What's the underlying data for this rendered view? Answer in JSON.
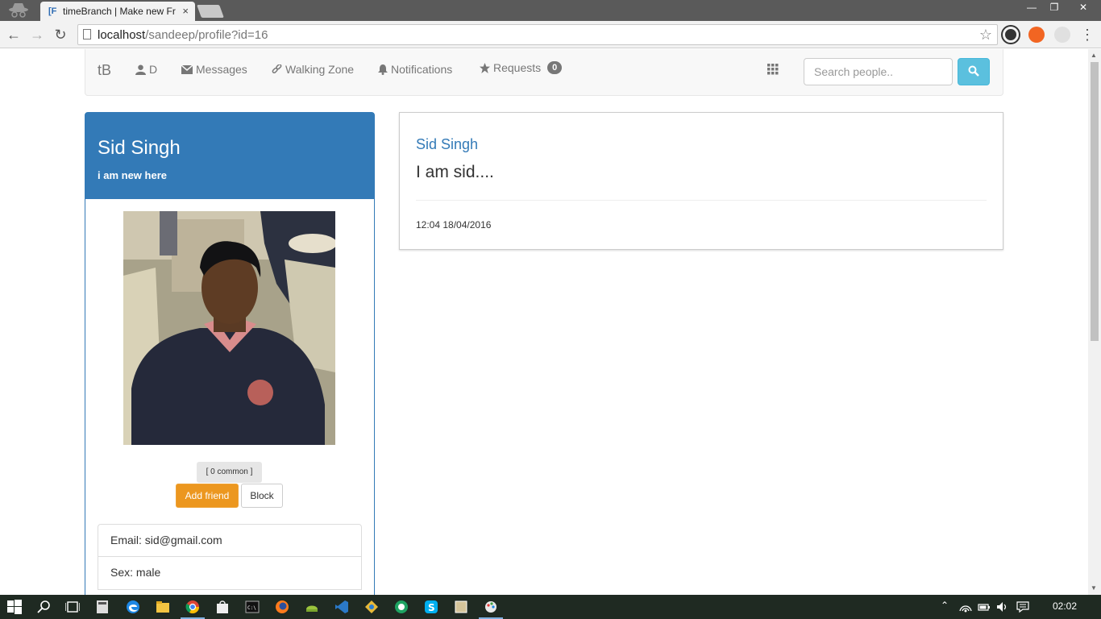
{
  "browser": {
    "tab_title": "timeBranch | Make new Fr",
    "tab_favicon": "[F",
    "tab_close": "×",
    "url_host": "localhost",
    "url_path": "/sandeep/profile?id=16",
    "icons": [
      "incognito-icon",
      "back-icon",
      "forward-icon",
      "reload-icon",
      "page-icon",
      "bookmark-star-icon",
      "menu-icon"
    ]
  },
  "navbar": {
    "brand": "tB",
    "user": "D",
    "messages": "Messages",
    "walking_zone": "Walking Zone",
    "notifications": "Notifications",
    "requests": "Requests",
    "requests_count": "0",
    "search_placeholder": "Search people.."
  },
  "profile": {
    "name": "Sid Singh",
    "status": "i am new here",
    "common": "[ 0 common ]",
    "add_friend": "Add friend",
    "block": "Block",
    "info": [
      "Email: sid@gmail.com",
      "Sex: male"
    ]
  },
  "post": {
    "author": "Sid Singh",
    "text": "I am sid....",
    "time": "12:04 18/04/2016"
  },
  "taskbar": {
    "clock": "02:02"
  },
  "colors": {
    "primary": "#337ab7",
    "warning": "#ec971f",
    "info": "#5bc0de",
    "taskbar": "#1f2a22"
  }
}
